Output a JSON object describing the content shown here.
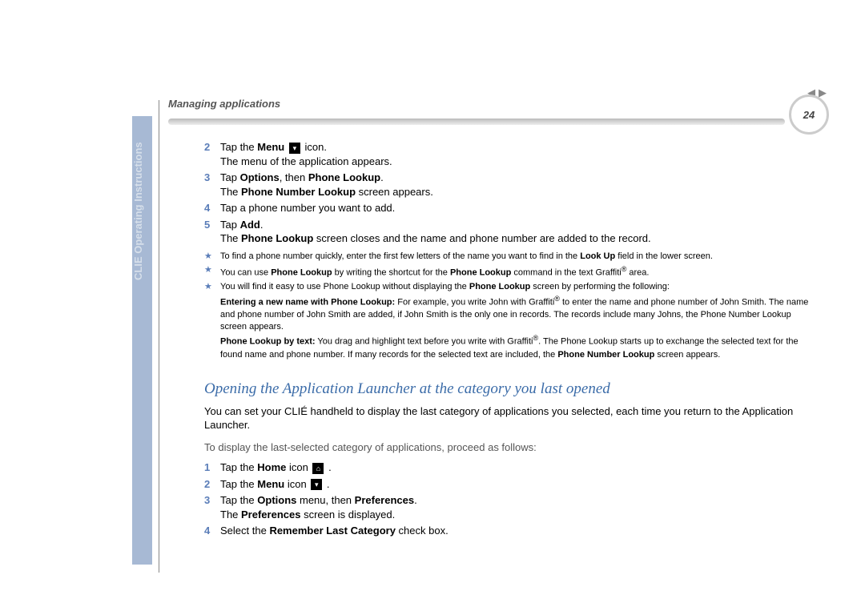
{
  "header": "Managing applications",
  "page_number": "24",
  "sidebar_label": "CLIE Operating Instructions",
  "steps_a": {
    "2": {
      "pre": "Tap the ",
      "bold1": "Menu",
      "post": " icon.",
      "line2": "The menu of the application appears."
    },
    "3": {
      "pre": "Tap ",
      "bold1": "Options",
      "mid": ", then ",
      "bold2": "Phone Lookup",
      "post": ".",
      "line2a": "The ",
      "line2b": "Phone Number Lookup",
      "line2c": " screen appears."
    },
    "4": {
      "text": "Tap a phone number you want to add."
    },
    "5": {
      "pre": "Tap ",
      "bold": "Add",
      "post": ".",
      "line2a": "The ",
      "line2b": "Phone Lookup",
      "line2c": " screen closes and the name and phone number are added to the record."
    }
  },
  "tips": {
    "1": {
      "a": "To find a phone number quickly, enter the first few letters of the name you want to find in the ",
      "b": "Look Up",
      "c": " field in the lower screen."
    },
    "2": {
      "a": "You can use ",
      "b": "Phone Lookup",
      "c": " by writing the shortcut for the ",
      "d": "Phone Lookup",
      "e": " command in the text Graffiti",
      "f": " area."
    },
    "3": {
      "a": "You will find it easy to use Phone Lookup without displaying the ",
      "b": "Phone Lookup",
      "c": " screen by performing the following:",
      "d1": "Entering a new name with Phone Lookup:",
      "d2": " For example, you write John with Graffiti",
      "d3": " to enter the name and phone number of John Smith. The name and phone number of John Smith are added, if John Smith is the only one in records. The records include many Johns, the Phone Number Lookup screen appears.",
      "e1": "Phone Lookup by text:",
      "e2": " You drag and highlight text before you write with Graffiti",
      "e3": ". The Phone Lookup starts up to exchange the selected text for the found name and phone number. If many records for the selected text are included, the ",
      "e4": "Phone Number Lookup",
      "e5": " screen appears."
    }
  },
  "section_title": "Opening the Application Launcher at the category you last opened",
  "para1": "You can set your CLIÉ handheld to display the last category of applications you selected, each time you return to the Application Launcher.",
  "para2": "To display the last-selected category of applications, proceed as follows:",
  "steps_b": {
    "1": {
      "pre": "Tap the ",
      "bold": "Home",
      "post": " icon "
    },
    "2": {
      "pre": "Tap the ",
      "bold": "Menu",
      "post": " icon "
    },
    "3": {
      "pre": "Tap the ",
      "bold1": "Options",
      "mid": " menu, then ",
      "bold2": "Preferences",
      "post": ".",
      "line2a": "The ",
      "line2b": "Preferences",
      "line2c": " screen is displayed."
    },
    "4": {
      "pre": "Select the ",
      "bold": "Remember Last Category",
      "post": " check box."
    }
  }
}
